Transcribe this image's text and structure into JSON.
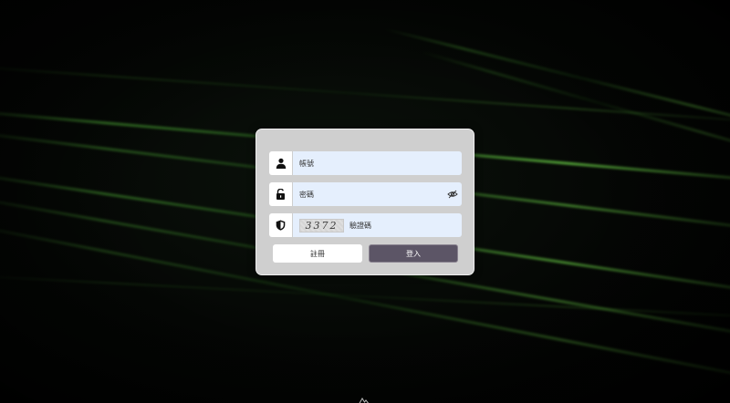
{
  "login": {
    "account_placeholder": "帳號",
    "password_placeholder": "密碼",
    "captcha_code": "3372",
    "captcha_placeholder": "驗證碼",
    "register_label": "註冊",
    "login_label": "登入"
  },
  "icons": {
    "account": "user-icon",
    "password": "unlock-icon",
    "captcha": "shield-icon",
    "toggle": "eye-off-icon",
    "footer": "mountain-logo-icon"
  },
  "colors": {
    "card_bg": "#cfcfcf",
    "input_bg": "#e5effd",
    "login_button": "#5c5566",
    "register_button": "#ffffff",
    "accent_light": "#64dc46"
  }
}
